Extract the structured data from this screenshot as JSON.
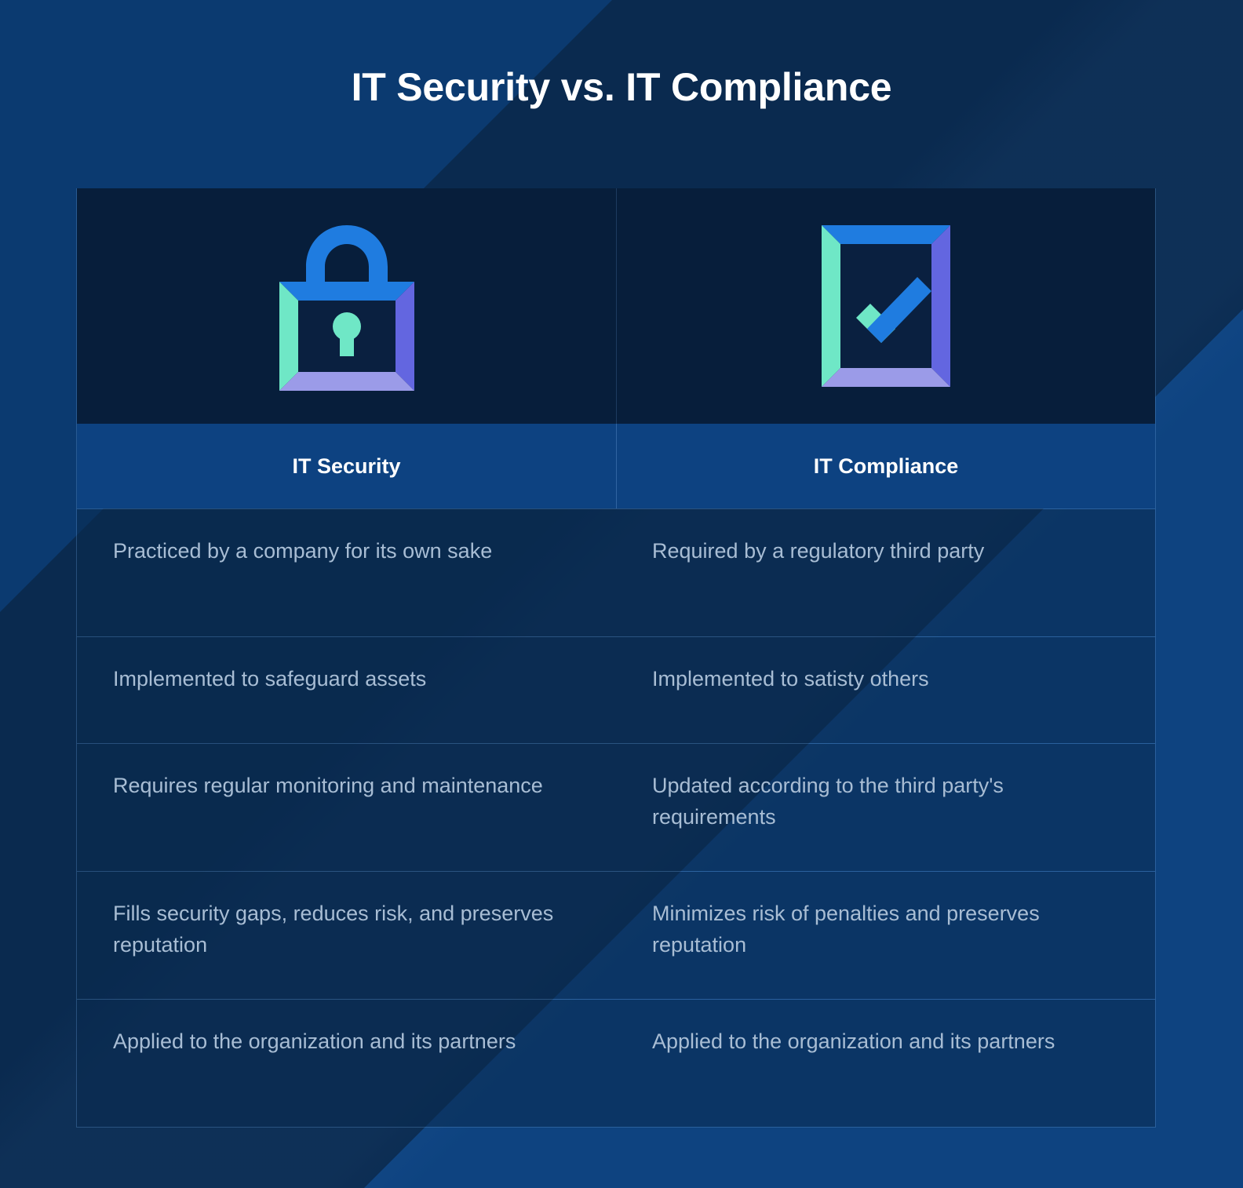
{
  "title": "IT Security vs. IT Compliance",
  "colors": {
    "background_dark": "#0a2a4f",
    "background_light": "#0e4380",
    "icon_panel": "#071e3b",
    "header_band": "#0d4281",
    "body_text": "#a8bdd4",
    "heading_text": "#ffffff",
    "accent_blue": "#1f7ce0",
    "accent_mint": "#6fe7c6",
    "accent_purple": "#6366e0",
    "accent_lavender": "#9b9be8"
  },
  "columns": [
    {
      "id": "it-security",
      "label": "IT Security",
      "icon": "lock-icon"
    },
    {
      "id": "it-compliance",
      "label": "IT Compliance",
      "icon": "checkbox-check-icon"
    }
  ],
  "rows": [
    {
      "security": "Practiced by a company for its own sake",
      "compliance": "Required by a regulatory third party"
    },
    {
      "security": "Implemented to safeguard assets",
      "compliance": "Implemented to satisty others"
    },
    {
      "security": "Requires regular monitoring and maintenance",
      "compliance": "Updated according to the third party's requirements"
    },
    {
      "security": "Fills security gaps, reduces risk, and preserves reputation",
      "compliance": "Minimizes risk of penalties and preserves reputation"
    },
    {
      "security": "Applied to the organization and its partners",
      "compliance": "Applied to the organization and its partners"
    }
  ]
}
